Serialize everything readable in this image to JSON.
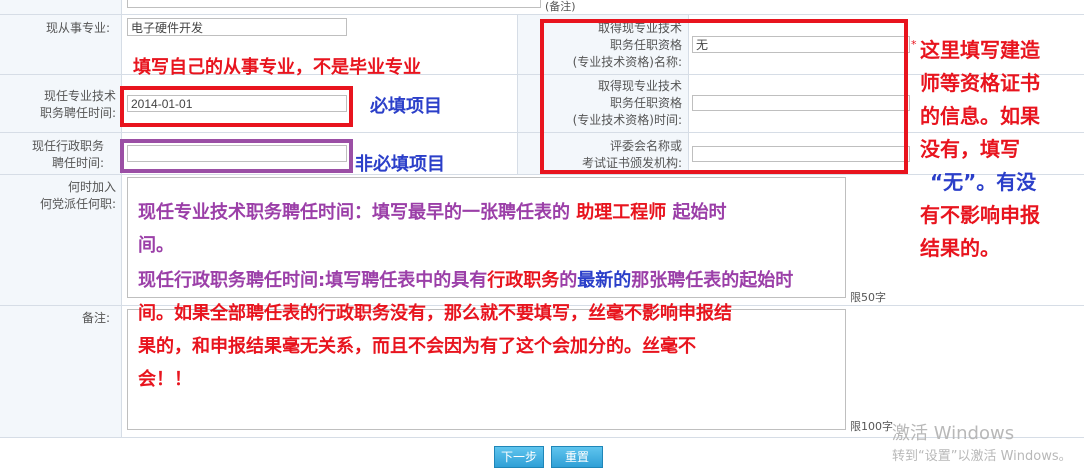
{
  "top_note": "(备注)",
  "fields": {
    "major": {
      "label": "现从事专业:",
      "value": "电子硬件开发"
    },
    "qual_name": {
      "label_lines": [
        "取得现专业技术",
        "职务任职资格",
        "(专业技术资格)名称:"
      ],
      "value": "无",
      "required_mark": "*"
    },
    "prof_time": {
      "label_lines": [
        "现任专业技术",
        "职务聘任时间:"
      ],
      "value": "2014-01-01"
    },
    "qual_time": {
      "label_lines": [
        "取得现专业技术",
        "职务任职资格",
        "(专业技术资格)时间:"
      ],
      "value": ""
    },
    "admin_time": {
      "label_lines": [
        "现任行政职务",
        "聘任时间:"
      ],
      "value": ""
    },
    "committee": {
      "label_lines": [
        "评委会名称或",
        "考试证书颁发机构:"
      ],
      "value": ""
    },
    "party": {
      "label_lines": [
        "何时加入",
        "何党派任何职:"
      ],
      "value": "",
      "limit": "限50字"
    },
    "remarks": {
      "label": "备注:",
      "value": "",
      "limit": "限100字"
    }
  },
  "annotations": {
    "major_hint": "填写自己的从事专业，不是毕业专业",
    "required": "必填项目",
    "optional": "非必填项目",
    "qual_hint_lines": [
      "这里填写建造",
      "师等资格证书",
      "的信息。如果",
      "没有，填写",
      "“无”。有没",
      "有不影响申报",
      "结果的。"
    ],
    "prof_time_note_a": "现任专业技术职务聘任时间：填写最早的一张聘任表的 ",
    "prof_time_note_b": "助理工程师",
    "prof_time_note_c": " 起始时",
    "prof_time_note_d": "间。",
    "admin_note_a": "现任行政职务聘任时间:填写聘任表中的具有",
    "admin_note_b": "行政职务",
    "admin_note_c": "的",
    "admin_note_d": "最新的",
    "admin_note_e": "那张聘任表的起始时",
    "admin_note_f": "间。如果全部聘任表的行政职务没有，那么就不要填写，丝毫不影响申报结",
    "admin_note_g": "果的，和申报结果毫无关系，而且不会因为有了这个会加分的。丝毫不",
    "admin_note_h": "会！！"
  },
  "buttons": {
    "next": "下一步",
    "reset": "重置"
  },
  "watermark": {
    "line1": "激活 Windows",
    "line2": "转到“设置”以激活 Windows。"
  }
}
